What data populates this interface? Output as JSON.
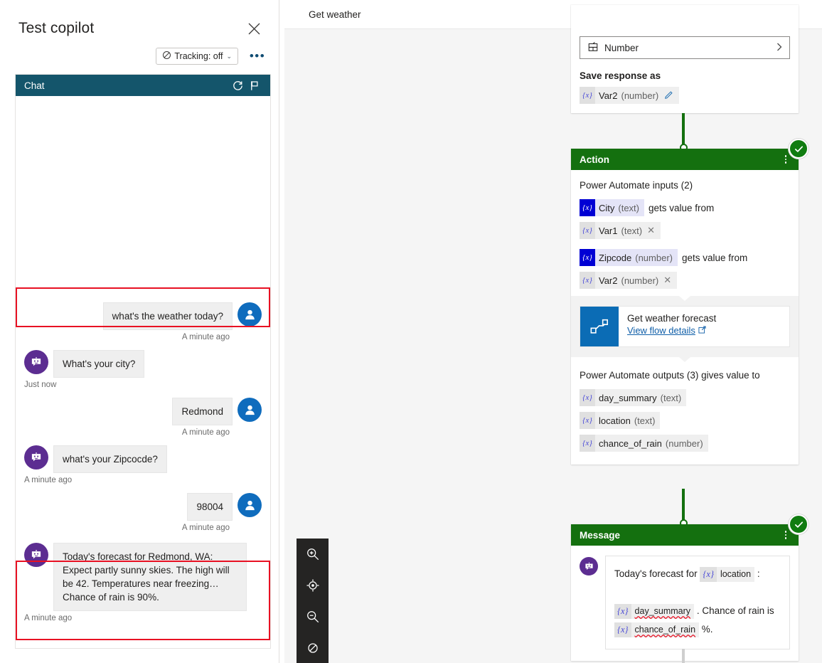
{
  "test_panel": {
    "title": "Test copilot",
    "close_icon": "close-icon",
    "tracking": {
      "label": "Tracking: off",
      "icon": "tracking-off-icon",
      "chevron": "⌄"
    },
    "more_label": "•••",
    "chat": {
      "header_title": "Chat",
      "refresh_icon": "refresh-icon",
      "flag_icon": "flag-icon"
    },
    "messages": [
      {
        "role": "user",
        "text": "what's the weather today?",
        "time": "A minute ago",
        "highlighted": true
      },
      {
        "role": "bot",
        "text": "What's your city?",
        "time": "Just now",
        "highlighted": false
      },
      {
        "role": "user",
        "text": "Redmond",
        "time": "A minute ago",
        "highlighted": false
      },
      {
        "role": "bot",
        "text": "what's your Zipcocde?",
        "time": "A minute ago",
        "highlighted": false
      },
      {
        "role": "user",
        "text": "98004",
        "time": "A minute ago",
        "highlighted": false
      },
      {
        "role": "bot",
        "text": "Today's forecast for Redmond, WA: Expect partly sunny skies. The high will be 42. Temperatures near freezing… Chance of rain is 90%.",
        "time": "A minute ago",
        "highlighted": true
      }
    ]
  },
  "canvas": {
    "topic_title": "Get weather",
    "question_node": {
      "identify_field": {
        "icon": "entity-icon",
        "value": "Number",
        "chevron": "›"
      },
      "save_response_label": "Save response as",
      "variable": {
        "badge": "{x}",
        "name": "Var2",
        "type": "(number)",
        "edit_icon": "pencil-icon"
      }
    },
    "action_node": {
      "header": "Action",
      "status_icon": "check-circle-icon",
      "kebab_icon": "more-vertical-icon",
      "inputs_label": "Power Automate inputs (2)",
      "inputs": [
        {
          "param": {
            "badge": "{x}",
            "name": "City",
            "type": "(text)"
          },
          "connector_text": "gets value from",
          "value": {
            "badge": "{x}",
            "name": "Var1",
            "type": "(text)",
            "remove_icon": "close-icon"
          }
        },
        {
          "param": {
            "badge": "{x}",
            "name": "Zipcode",
            "type": "(number)"
          },
          "connector_text": "gets value from",
          "value": {
            "badge": "{x}",
            "name": "Var2",
            "type": "(number)",
            "remove_icon": "close-icon"
          }
        }
      ],
      "flow": {
        "icon": "power-automate-icon",
        "name": "Get weather forecast",
        "link_label": "View flow details",
        "external_icon": "open-in-new-icon"
      },
      "outputs_label": "Power Automate outputs (3) gives value to",
      "outputs": [
        {
          "badge": "{x}",
          "name": "day_summary",
          "type": "(text)"
        },
        {
          "badge": "{x}",
          "name": "location",
          "type": "(text)"
        },
        {
          "badge": "{x}",
          "name": "chance_of_rain",
          "type": "(number)"
        }
      ]
    },
    "message_node": {
      "header": "Message",
      "status_icon": "check-circle-icon",
      "kebab_icon": "more-vertical-icon",
      "avatar_icon": "bot-icon",
      "line1_prefix": "Today's forecast for",
      "line1_token": {
        "badge": "{x}",
        "name": "location"
      },
      "line1_suffix": ":",
      "line2_token": {
        "badge": "{x}",
        "name": "day_summary"
      },
      "line2_mid": ". Chance of rain is",
      "line3_token": {
        "badge": "{x}",
        "name": "chance_of_rain"
      },
      "line3_suffix": "%."
    },
    "zoom_toolbar": {
      "buttons": [
        {
          "icon": "zoom-in-icon"
        },
        {
          "icon": "fit-to-screen-icon"
        },
        {
          "icon": "zoom-out-icon"
        },
        {
          "icon": "reset-zoom-icon"
        }
      ]
    }
  },
  "colors": {
    "chat_header": "#14556b",
    "node_header_green": "#14700f",
    "status_green": "#107c10",
    "user_avatar_blue": "#0f6cbd",
    "bot_avatar_purple": "#5c2d91",
    "highlight_red": "#e81123",
    "input_chip_blue": "#0000d4",
    "flow_icon_blue": "#0b6cb5"
  }
}
